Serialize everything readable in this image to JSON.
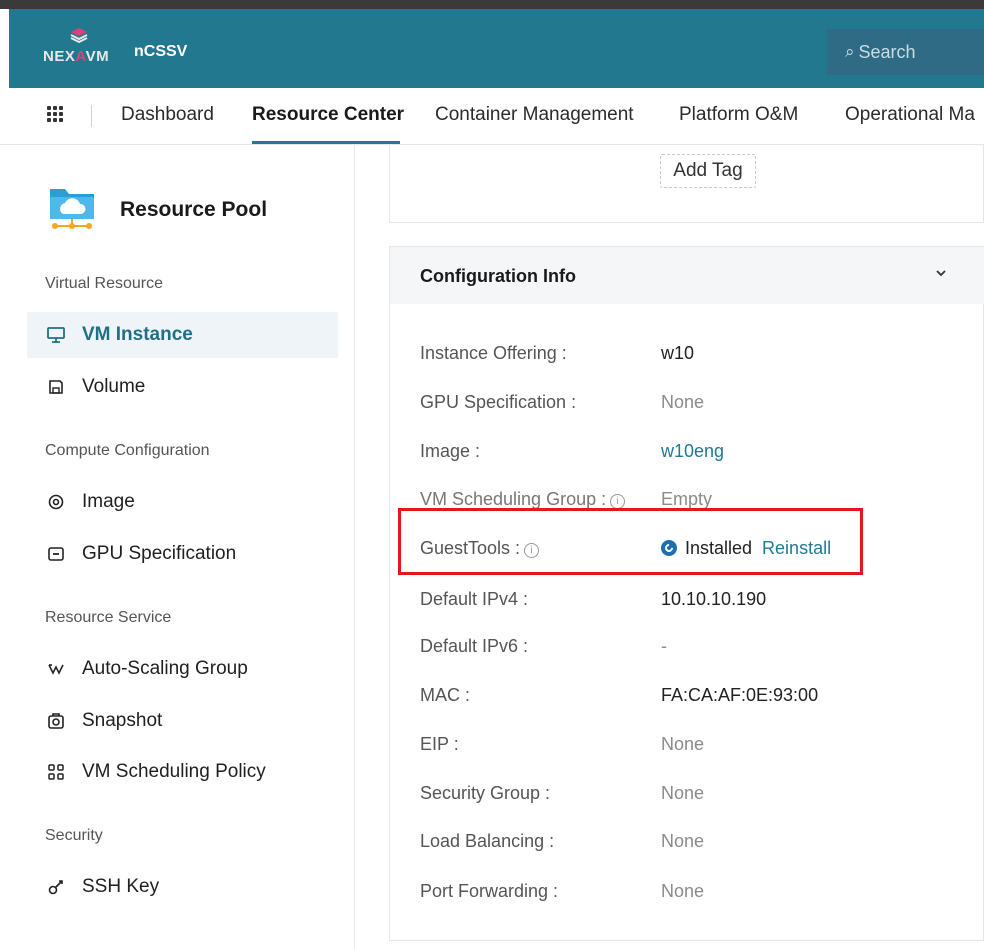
{
  "header": {
    "logo_text_a": "NEX",
    "logo_text_b": "A",
    "logo_text_c": "VM",
    "product": "nCSSV",
    "search_placeholder": "Search"
  },
  "nav": {
    "items": [
      "Dashboard",
      "Resource Center",
      "Container Management",
      "Platform O&M",
      "Operational Ma"
    ]
  },
  "sidebar": {
    "title": "Resource Pool",
    "sections": [
      {
        "label": "Virtual Resource",
        "items": [
          {
            "label": "VM Instance",
            "icon": "monitor-icon"
          },
          {
            "label": "Volume",
            "icon": "disk-icon"
          }
        ]
      },
      {
        "label": "Compute Configuration",
        "items": [
          {
            "label": "Image",
            "icon": "image-disc-icon"
          },
          {
            "label": "GPU Specification",
            "icon": "gpu-card-icon"
          }
        ]
      },
      {
        "label": "Resource Service",
        "items": [
          {
            "label": "Auto-Scaling Group",
            "icon": "scaling-icon"
          },
          {
            "label": "Snapshot",
            "icon": "camera-icon"
          },
          {
            "label": "VM Scheduling Policy",
            "icon": "scheduling-icon"
          }
        ]
      },
      {
        "label": "Security",
        "items": [
          {
            "label": "SSH Key",
            "icon": "key-icon"
          }
        ]
      }
    ]
  },
  "tags": {
    "add_tag": "Add Tag"
  },
  "config": {
    "title": "Configuration Info",
    "rows": [
      {
        "label": "Instance Offering :",
        "value": "w10"
      },
      {
        "label": "GPU Specification :",
        "value": "None"
      },
      {
        "label": "Image :",
        "value": "w10eng"
      },
      {
        "label": "VM Scheduling Group :",
        "value": "Empty"
      },
      {
        "label": "GuestTools :",
        "value": "Installed",
        "action": "Reinstall"
      },
      {
        "label": "Default IPv4 :",
        "value": "10.10.10.190"
      },
      {
        "label": "Default IPv6 :",
        "value": "-"
      },
      {
        "label": "MAC :",
        "value": "FA:CA:AF:0E:93:00"
      },
      {
        "label": "EIP :",
        "value": "None"
      },
      {
        "label": "Security Group :",
        "value": "None"
      },
      {
        "label": "Load Balancing :",
        "value": "None"
      },
      {
        "label": "Port Forwarding :",
        "value": "None"
      }
    ]
  },
  "colors": {
    "header_bg": "#22788f",
    "accent": "#1f7a93",
    "highlight": "#e8141e"
  }
}
